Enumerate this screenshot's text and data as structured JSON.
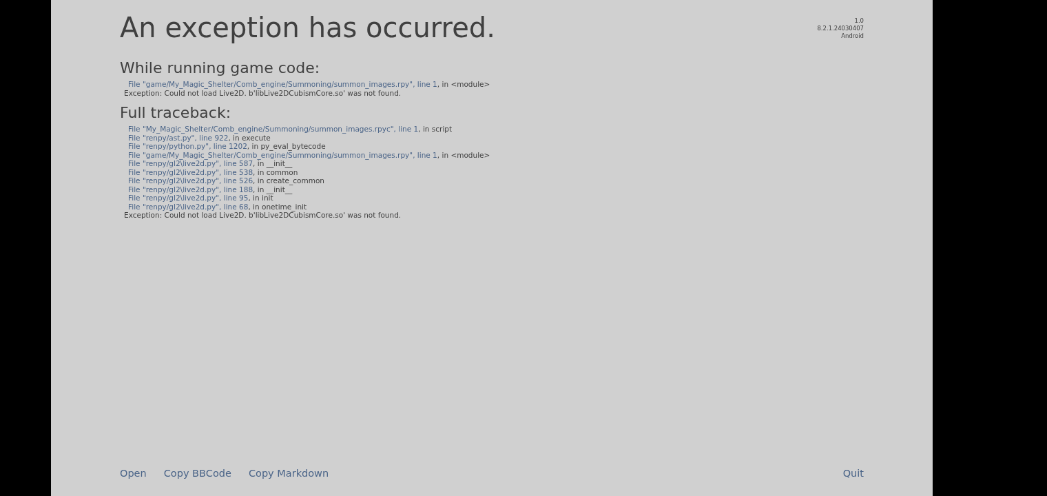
{
  "title": "An exception has occurred.",
  "version": [
    "1.0",
    "8.2.1.24030407",
    "Android"
  ],
  "sections": [
    {
      "heading": "While running game code:",
      "frames": [
        {
          "link": "File \"game/My_Magic_Shelter/Comb_engine/Summoning/summon_images.rpy\", line 1",
          "rest": ", in <module>"
        }
      ],
      "error": "Exception: Could not load Live2D. b'libLive2DCubismCore.so' was not found."
    },
    {
      "heading": "Full traceback:",
      "frames": [
        {
          "link": "File \"My_Magic_Shelter/Comb_engine/Summoning/summon_images.rpyc\", line 1",
          "rest": ", in script"
        },
        {
          "link": "File \"renpy/ast.py\", line 922",
          "rest": ", in execute"
        },
        {
          "link": "File \"renpy/python.py\", line 1202",
          "rest": ", in py_eval_bytecode"
        },
        {
          "link": "File \"game/My_Magic_Shelter/Comb_engine/Summoning/summon_images.rpy\", line 1",
          "rest": ", in <module>"
        },
        {
          "link": "File \"renpy/gl2\\live2d.py\", line 587",
          "rest": ", in __init__"
        },
        {
          "link": "File \"renpy/gl2\\live2d.py\", line 538",
          "rest": ", in common"
        },
        {
          "link": "File \"renpy/gl2\\live2d.py\", line 526",
          "rest": ", in create_common"
        },
        {
          "link": "File \"renpy/gl2\\live2d.py\", line 188",
          "rest": ", in __init__"
        },
        {
          "link": "File \"renpy/gl2\\live2d.py\", line 95",
          "rest": ", in init"
        },
        {
          "link": "File \"renpy/gl2\\live2d.py\", line 68",
          "rest": ", in onetime_init"
        }
      ],
      "error": "Exception: Could not load Live2D. b'libLive2DCubismCore.so' was not found."
    }
  ],
  "actions": [
    "Open",
    "Copy BBCode",
    "Copy Markdown"
  ],
  "quit": "Quit"
}
